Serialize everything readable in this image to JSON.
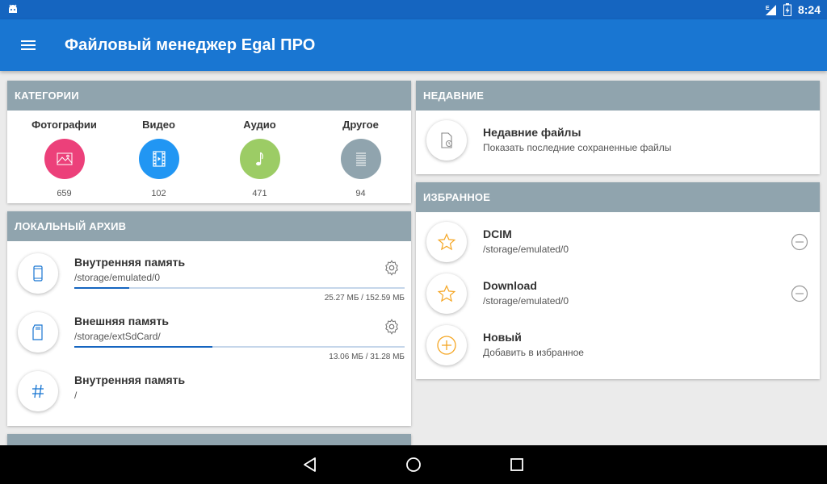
{
  "status": {
    "network": "E",
    "time": "8:24"
  },
  "app": {
    "title": "Файловый менеджер Egal ПРО"
  },
  "categories": {
    "header": "КАТЕГОРИИ",
    "items": [
      {
        "label": "Фотографии",
        "count": "659",
        "color": "#ec407a",
        "icon": "image-icon"
      },
      {
        "label": "Видео",
        "count": "102",
        "color": "#2196f3",
        "icon": "film-icon"
      },
      {
        "label": "Аудио",
        "count": "471",
        "color": "#9ccc65",
        "icon": "music-note-icon"
      },
      {
        "label": "Другое",
        "count": "94",
        "color": "#90a4ae",
        "icon": "document-icon"
      }
    ]
  },
  "local": {
    "header": "ЛОКАЛЬНЫЙ АРХИВ",
    "items": [
      {
        "title": "Внутренняя память",
        "path": "/storage/emulated/0",
        "size": "25.27 МБ / 152.59 МБ",
        "used_fraction": 0.166
      },
      {
        "title": "Внешняя память",
        "path": "/storage/extSdCard/",
        "size": "13.06 МБ / 31.28 МБ",
        "used_fraction": 0.418
      },
      {
        "title": "Внутренняя память",
        "path": "/"
      }
    ]
  },
  "recent": {
    "header": "НЕДАВНИЕ",
    "title": "Недавние файлы",
    "subtitle": "Показать последние сохраненные файлы"
  },
  "favorites": {
    "header": "ИЗБРАННОЕ",
    "items": [
      {
        "title": "DCIM",
        "path": "/storage/emulated/0"
      },
      {
        "title": "Download",
        "path": "/storage/emulated/0"
      },
      {
        "title": "Новый",
        "path": "Добавить в избранное"
      }
    ]
  },
  "colors": {
    "accent": "#1976d2",
    "header": "#90a4ae",
    "star": "#f5a623"
  }
}
